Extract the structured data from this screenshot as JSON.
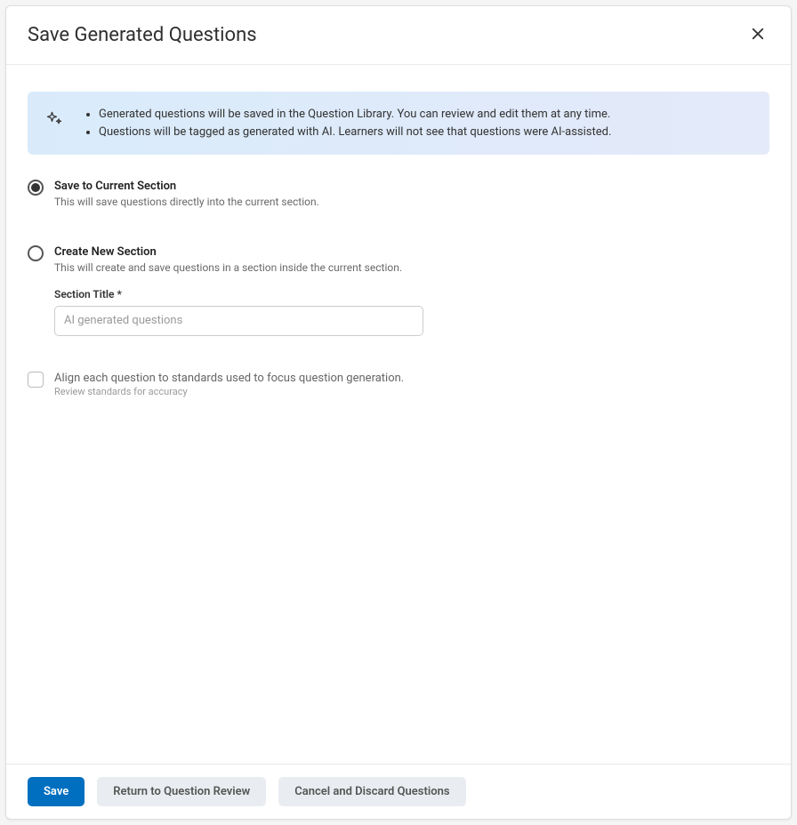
{
  "header": {
    "title": "Save Generated Questions"
  },
  "info_banner": {
    "bullets": [
      "Generated questions will be saved in the Question Library. You can review and edit them at any time.",
      "Questions will be tagged as generated with AI. Learners will not see that questions were AI-assisted."
    ]
  },
  "options": {
    "save_current": {
      "title": "Save to Current Section",
      "description": "This will save questions directly into the current section."
    },
    "create_new": {
      "title": "Create New Section",
      "description": "This will create and save questions in a section inside the current section.",
      "field_label": "Section Title *",
      "placeholder": "AI generated questions"
    },
    "align": {
      "title": "Align each question to standards used to focus question generation.",
      "description": "Review standards for accuracy"
    }
  },
  "footer": {
    "save": "Save",
    "return": "Return to Question Review",
    "cancel": "Cancel and Discard Questions"
  }
}
